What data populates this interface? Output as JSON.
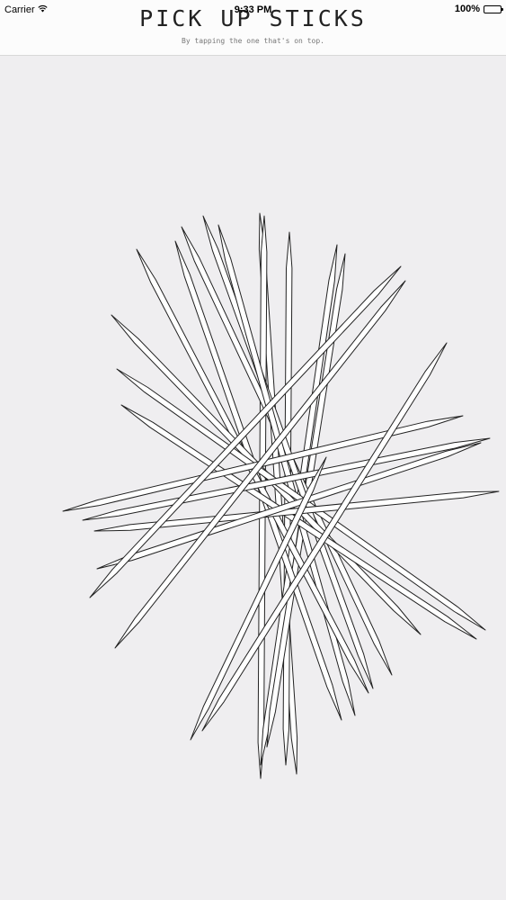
{
  "status_bar": {
    "carrier": "Carrier",
    "wifi_icon": "wifi-icon",
    "time": "9:33 PM",
    "battery": "100%",
    "battery_level": 1.0
  },
  "header": {
    "title": "PICK UP STICKS",
    "subtitle": "By tapping the one that's on top."
  },
  "game": {
    "stick_count": 24,
    "stick_color": "#ffffff",
    "stick_outline_color": "#222222",
    "background_color": "#efeef0"
  }
}
